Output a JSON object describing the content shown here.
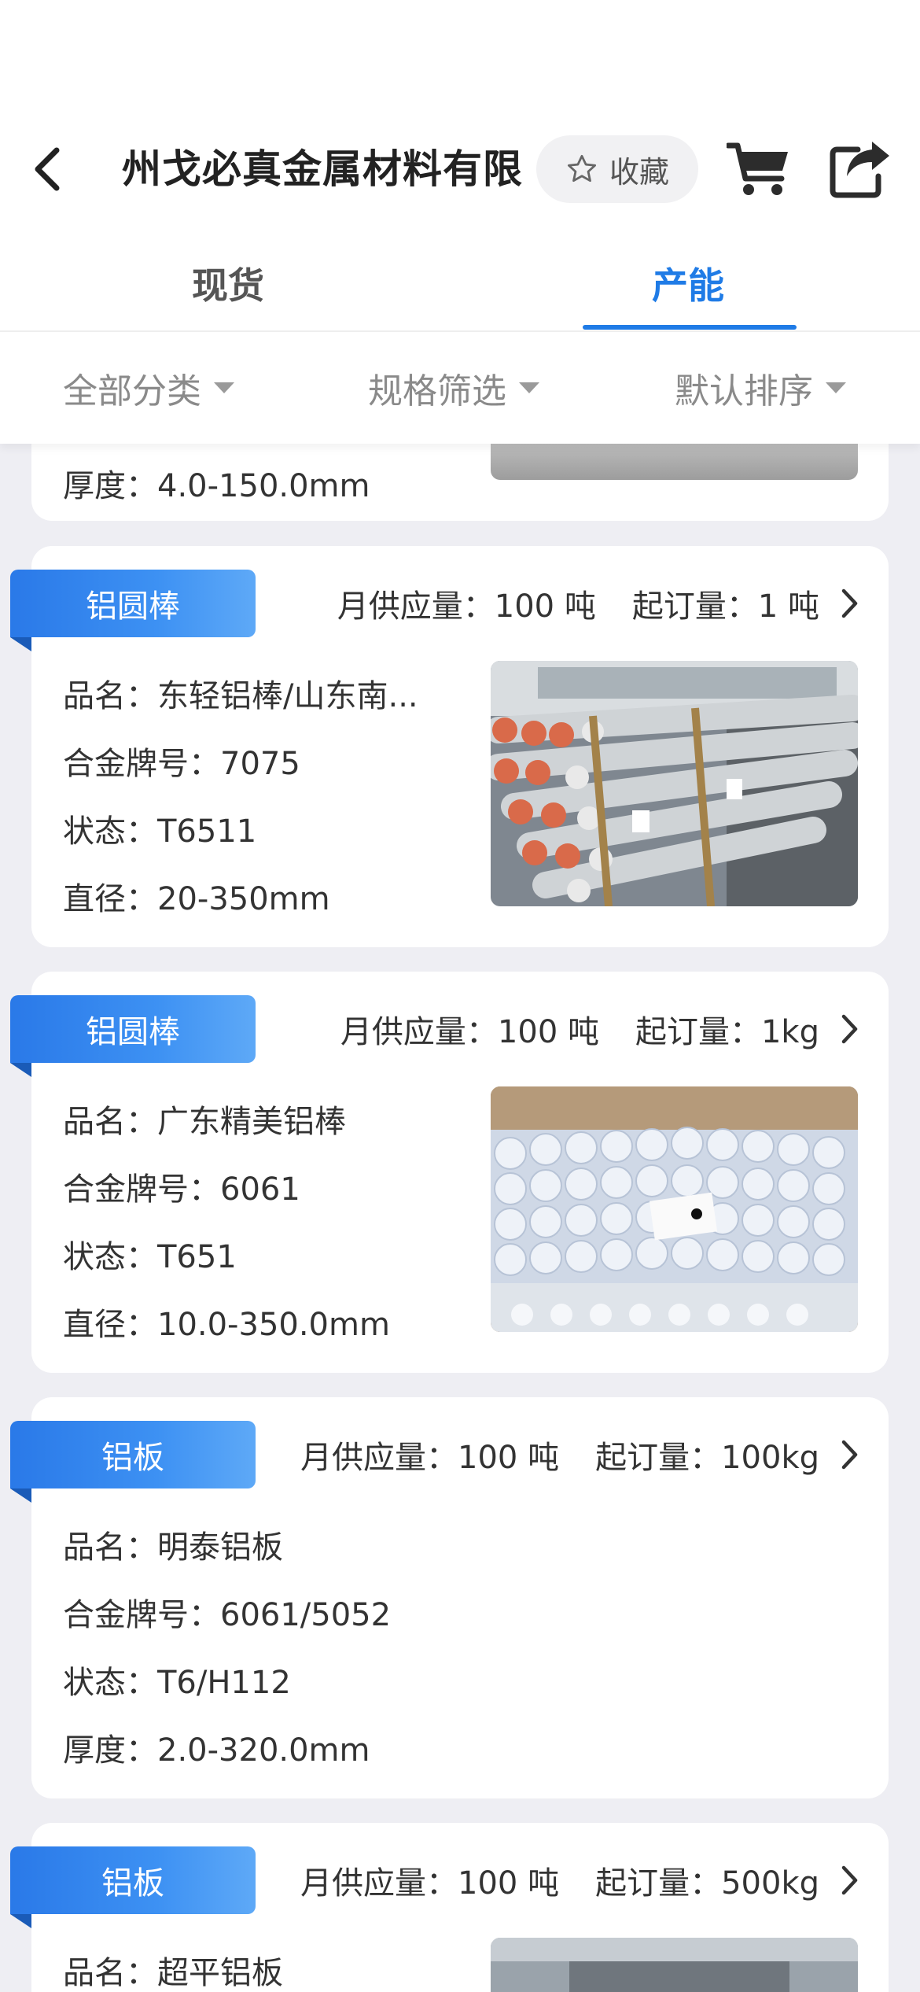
{
  "header": {
    "title": "州戈必真金属材料有限",
    "favorite_label": "收藏",
    "icons": {
      "back": "chevron-left-icon",
      "favorite": "star-outline-icon",
      "cart": "cart-icon",
      "share": "share-icon"
    }
  },
  "tabs": [
    {
      "label": "现货",
      "active": false
    },
    {
      "label": "产能",
      "active": true
    }
  ],
  "filters": [
    {
      "label": "全部分类"
    },
    {
      "label": "规格筛选"
    },
    {
      "label": "默认排序"
    }
  ],
  "colors": {
    "accent": "#1f7be6",
    "background": "#eeeef3"
  },
  "partial_card": {
    "thickness": "厚度：4.0-150.0mm"
  },
  "cards": [
    {
      "tag": "铝圆棒",
      "supply": "月供应量：100 吨",
      "min_order": "起订量：1 吨",
      "name": "品名：东轻铝棒/山东南...",
      "alloy": "合金牌号：7075",
      "state": "状态：T6511",
      "spec": "直径：20-350mm",
      "has_photo": true
    },
    {
      "tag": "铝圆棒",
      "supply": "月供应量：100 吨",
      "min_order": "起订量：1kg",
      "name": "品名：广东精美铝棒",
      "alloy": "合金牌号：6061",
      "state": "状态：T651",
      "spec": "直径：10.0-350.0mm",
      "has_photo": true
    },
    {
      "tag": "铝板",
      "supply": "月供应量：100 吨",
      "min_order": "起订量：100kg",
      "name": "品名：明泰铝板",
      "alloy": "合金牌号：6061/5052",
      "state": "状态：T6/H112",
      "spec": "厚度：2.0-320.0mm",
      "has_photo": false
    },
    {
      "tag": "铝板",
      "supply": "月供应量：100 吨",
      "min_order": "起订量：500kg",
      "name": "品名：超平铝板",
      "has_photo": true
    }
  ]
}
